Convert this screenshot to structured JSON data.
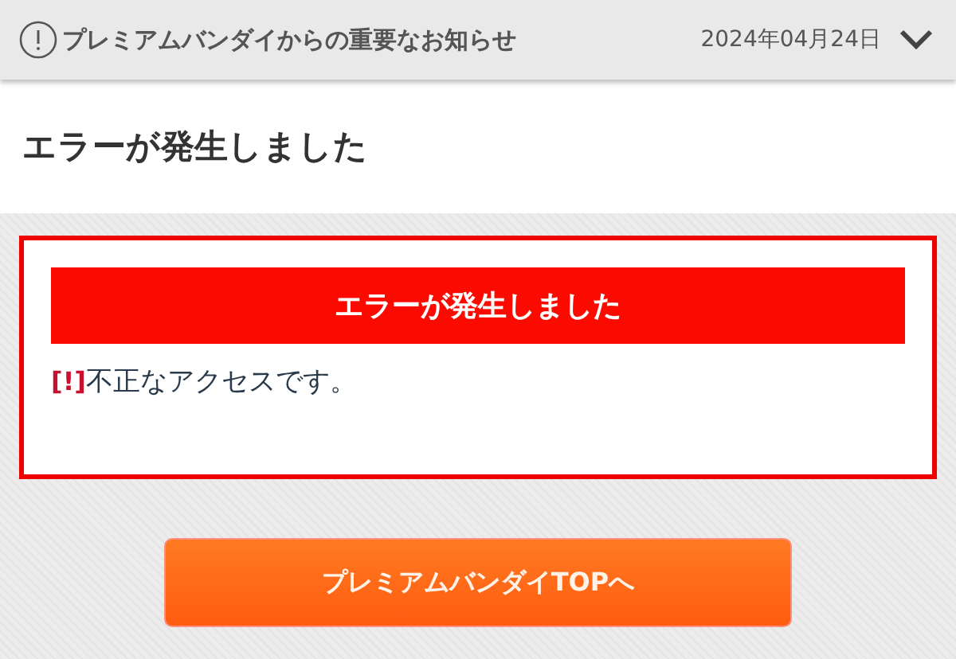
{
  "notice_bar": {
    "title": "プレミアムバンダイからの重要なお知らせ",
    "date": "2024年04月24日"
  },
  "page_title": "エラーが発生しました",
  "error_box": {
    "heading": "エラーが発生しました",
    "marker": "[!]",
    "message": "不正なアクセスです。"
  },
  "top_button": "プレミアムバンダイTOPへ"
}
